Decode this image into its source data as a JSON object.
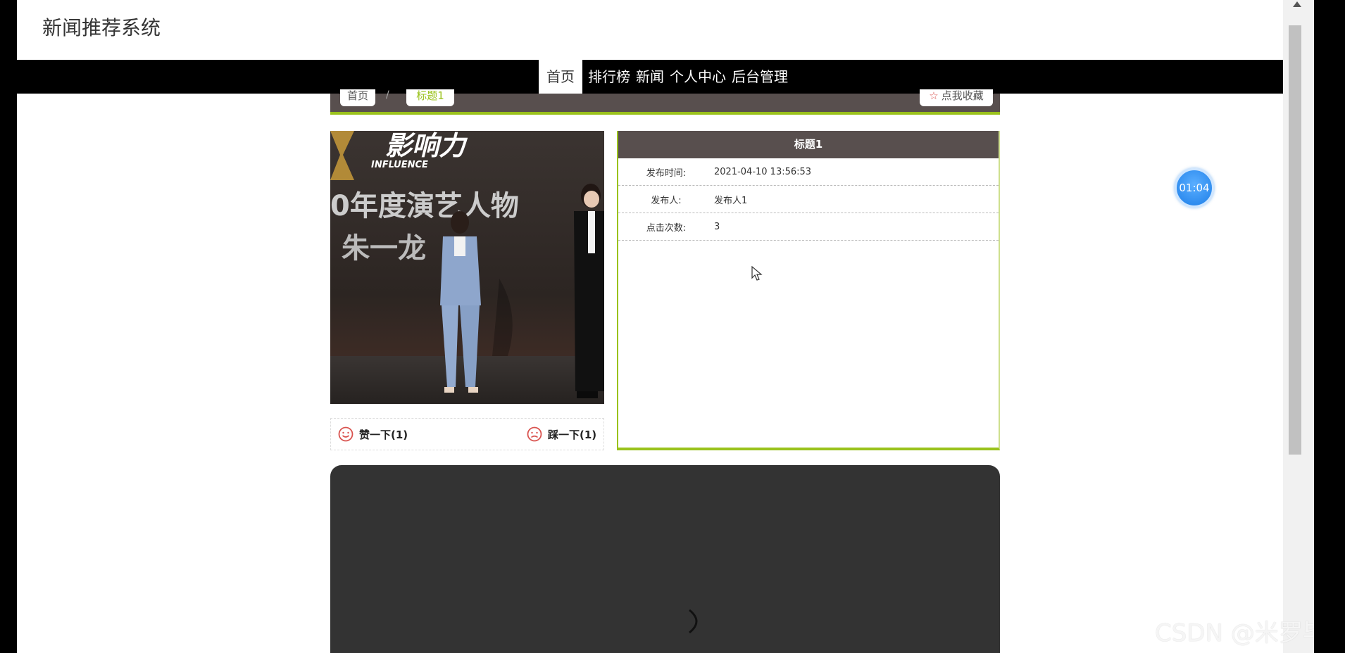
{
  "site": {
    "title": "新闻推荐系统"
  },
  "nav": {
    "items": [
      {
        "label": "首页"
      },
      {
        "label": "排行榜"
      },
      {
        "label": "新闻"
      },
      {
        "label": "个人中心"
      },
      {
        "label": "后台管理"
      }
    ],
    "active": "首页"
  },
  "breadcrumb": {
    "home": "首页",
    "separator": "/",
    "current": "标题1",
    "favorite_label": "点我收藏"
  },
  "article": {
    "title": "标题1",
    "rows": [
      {
        "label": "发布时间:",
        "value": "2021-04-10 13:56:53"
      },
      {
        "label": "发布人:",
        "value": "发布人1"
      },
      {
        "label": "点击次数:",
        "value": "3"
      }
    ],
    "image_text": {
      "brand": "影响力",
      "brand_en": "INFLUENCE",
      "line1": "0年度演艺人物",
      "line2": "朱一龙"
    }
  },
  "votes": {
    "like": "赞一下(1)",
    "dislike": "踩一下(1)"
  },
  "timer": {
    "text": "01:04"
  },
  "watermark": "CSDN @米罗毕设",
  "colors": {
    "accent": "#9ac21c",
    "header_bg": "#584f4e",
    "nav_bg": "#000000",
    "timer": "#1e7fe8"
  }
}
